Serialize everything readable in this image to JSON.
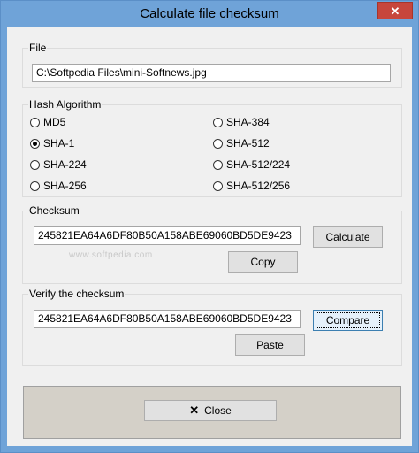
{
  "window": {
    "title": "Calculate file checksum",
    "close_glyph": "✕"
  },
  "file": {
    "label": "File",
    "path": "C:\\Softpedia Files\\mini-Softnews.jpg"
  },
  "hash": {
    "label": "Hash Algorithm",
    "selected": "SHA-1",
    "options": [
      "MD5",
      "SHA-1",
      "SHA-224",
      "SHA-256",
      "SHA-384",
      "SHA-512",
      "SHA-512/224",
      "SHA-512/256"
    ]
  },
  "checksum": {
    "label": "Checksum",
    "value": "245821EA64A6DF80B50A158ABE69060BD5DE9423",
    "calculate_label": "Calculate",
    "copy_label": "Copy"
  },
  "verify": {
    "label": "Verify the checksum",
    "value": "245821EA64A6DF80B50A158ABE69060BD5DE9423",
    "compare_label": "Compare",
    "paste_label": "Paste"
  },
  "footer": {
    "close_label": "Close",
    "close_icon": "✕"
  },
  "watermark": "www.softpedia.com"
}
